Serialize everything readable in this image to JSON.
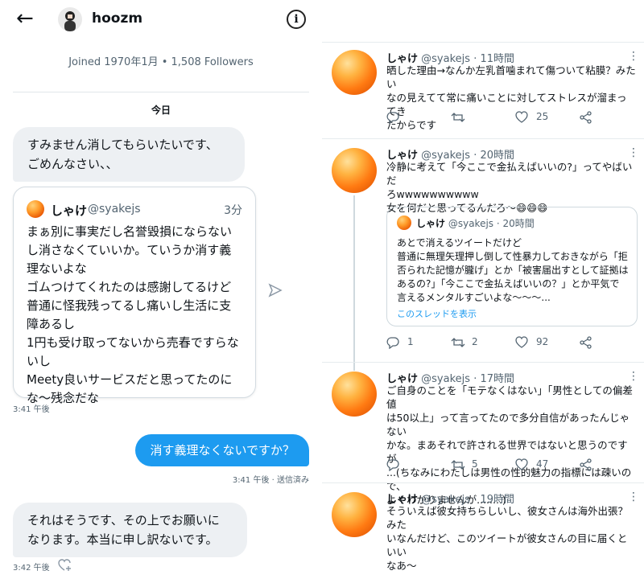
{
  "dm": {
    "header": {
      "username": "hoozm"
    },
    "profile_meta": "Joined 1970年1月 • 1,508 Followers",
    "date_separator": "今日",
    "msg1": {
      "lines": [
        "すみません消してもらいたいです、",
        "ごめんなさい、、"
      ],
      "time": "3:41 午後"
    },
    "shared_tweet": {
      "name": "しゃけ",
      "handle": "@syakejs",
      "time": "3分",
      "lines": [
        "まぁ別に事実だし名誉毀損にならない",
        "し消さなくていいか。ていうか消す義",
        "理ないよな",
        "ゴムつけてくれたのは感謝してるけど",
        "普通に怪我残ってるし痛いし生活に支",
        "障あるし",
        "1円も受け取ってないから売春ですらな",
        "いし",
        "Meety良いサービスだと思ってたのに",
        "な〜残念だな"
      ]
    },
    "msg2": {
      "text": "消す義理なくないですか？",
      "time": "3:41 午後 · 送信済み"
    },
    "msg3": {
      "lines": [
        "それはそうです、その上でお願いに",
        "なります。本当に申し訳ないです。"
      ],
      "time": "3:42 午後"
    }
  },
  "tweets": [
    {
      "name": "しゃけ",
      "handle": "@syakejs",
      "time": "· 11時間",
      "lines": [
        "晒した理由→なんか左乳首噛まれて傷ついて粘膜？みたい",
        "なの見えてて常に痛いことに対してストレスが溜まってき",
        "たからです"
      ],
      "replies": "",
      "retweets": "",
      "likes": "25"
    },
    {
      "name": "しゃけ",
      "handle": "@syakejs",
      "time": "· 20時間",
      "lines": [
        "冷静に考えて「今ここで金払えばいいの?」ってやばいだ",
        "ろwwwwwwwwww",
        "女を何だと思ってるんだろ〜😅😅😅"
      ],
      "quote": {
        "name": "しゃけ",
        "handle": "@syakejs",
        "time": "· 20時間",
        "lines": [
          "あとで消えるツイートだけど",
          "普通に無理矢理押し倒して性暴力しておきながら「拒",
          "否られた記憶が朧げ」とか「被害届出すとして証拠は",
          "あるの?」「今ここで金払えばいいの？」とか平気で",
          "言えるメンタルすごいよな〜〜〜..."
        ],
        "link": "このスレッドを表示"
      },
      "replies": "1",
      "retweets": "2",
      "likes": "92"
    },
    {
      "name": "しゃけ",
      "handle": "@syakejs",
      "time": "· 17時間",
      "lines": [
        "ご自身のことを「モテなくはない」「男性としての偏差値",
        "は50以上」って言ってたので多分自信があったんじゃない",
        "かな。まあそれで許される世界ではないと思うのですが",
        "...(ちなみにわたしは男性の性的魅力の指標には疎いので、",
        "よくわかりませんが........)"
      ],
      "replies": "",
      "retweets": "5",
      "likes": "47"
    },
    {
      "name": "しゃけ",
      "handle": "@syakejs",
      "time": "· 19時間",
      "lines": [
        "そういえば彼女持ちらしいし、彼女さんは海外出張？みた",
        "いなんだけど、このツイートが彼女さんの目に届くといい",
        "なあ〜"
      ]
    }
  ]
}
